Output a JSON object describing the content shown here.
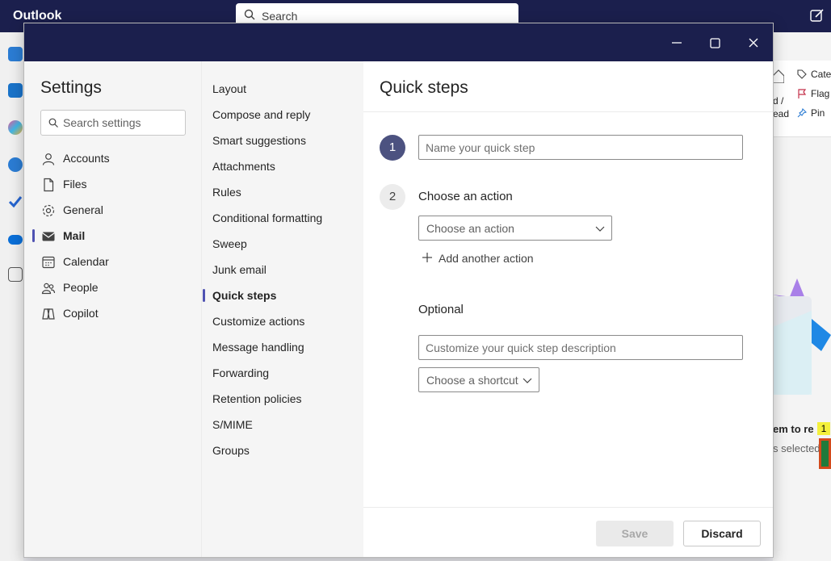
{
  "app": {
    "title": "Outlook",
    "search_label": "Search"
  },
  "ribbon": {
    "categorize": "Cate",
    "flag": "Flag",
    "pin": "Pin",
    "read_top": "d /",
    "read_bottom": "ead"
  },
  "reading_pane": {
    "line1": "em to re",
    "line2": "s selected",
    "badge": "1"
  },
  "settings": {
    "title": "Settings",
    "search_placeholder": "Search settings",
    "categories": [
      {
        "label": "Accounts",
        "icon": "person-icon"
      },
      {
        "label": "Files",
        "icon": "file-icon"
      },
      {
        "label": "General",
        "icon": "gear-icon"
      },
      {
        "label": "Mail",
        "icon": "mail-icon",
        "active": true
      },
      {
        "label": "Calendar",
        "icon": "calendar-icon"
      },
      {
        "label": "People",
        "icon": "people-icon"
      },
      {
        "label": "Copilot",
        "icon": "copilot-icon"
      }
    ],
    "mail_sections": [
      "Layout",
      "Compose and reply",
      "Smart suggestions",
      "Attachments",
      "Rules",
      "Conditional formatting",
      "Sweep",
      "Junk email",
      "Quick steps",
      "Customize actions",
      "Message handling",
      "Forwarding",
      "Retention policies",
      "S/MIME",
      "Groups"
    ],
    "active_section": "Quick steps"
  },
  "quick_steps": {
    "title": "Quick steps",
    "step1_number": "1",
    "name_placeholder": "Name your quick step",
    "step2_number": "2",
    "choose_action_label": "Choose an action",
    "action_dropdown": "Choose an action",
    "add_action": "Add another action",
    "optional_label": "Optional",
    "description_placeholder": "Customize your quick step description",
    "shortcut_dropdown": "Choose a shortcut",
    "save": "Save",
    "discard": "Discard"
  },
  "colors": {
    "titlebar": "#1b1f4d",
    "accent": "#4f52b2",
    "step_active": "#4c5280"
  }
}
